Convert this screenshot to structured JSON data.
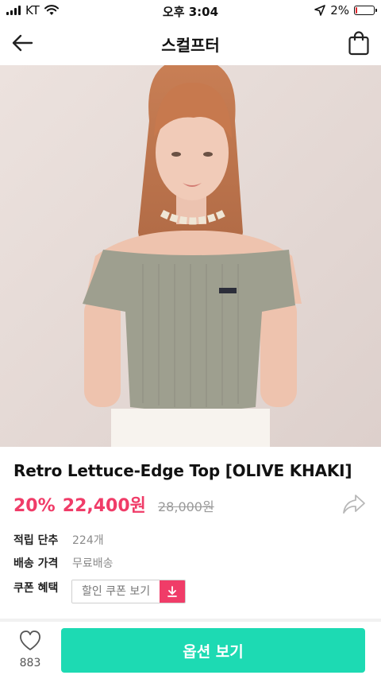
{
  "status": {
    "carrier": "KT",
    "time": "오후 3:04",
    "battery": "2%",
    "battery_level": 0.02
  },
  "nav": {
    "title": "스컬프터",
    "back_icon": "arrow-left-icon",
    "bag_icon": "shopping-bag-icon"
  },
  "product": {
    "name": "Retro Lettuce-Edge Top [OLIVE KHAKI]",
    "discount": "20%",
    "price": "22,400원",
    "original_price": "28,000원",
    "share_icon": "share-arrow-icon"
  },
  "info": [
    {
      "label": "적립 단추",
      "value": "224개"
    },
    {
      "label": "배송 가격",
      "value": "무료배송"
    },
    {
      "label": "쿠폰 혜택"
    }
  ],
  "coupon": {
    "text": "할인 쿠폰 보기",
    "icon": "download-icon"
  },
  "bottom": {
    "like_count": "883",
    "like_icon": "heart-icon",
    "option_label": "옵션 보기"
  },
  "colors": {
    "accent": "#1ddab3",
    "price": "#f03c68",
    "battery_low": "#e0242a"
  }
}
